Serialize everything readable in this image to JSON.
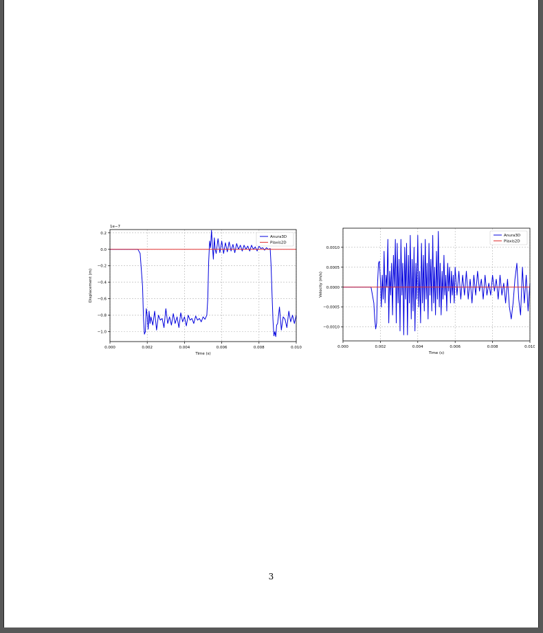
{
  "page": {
    "number": "3"
  },
  "chart_data": [
    {
      "type": "line",
      "title": "",
      "xlabel": "Time (s)",
      "ylabel": "Displacement (m)",
      "y_offset_text": "1e−7",
      "xlim": [
        0,
        0.01
      ],
      "ylim": [
        -1.12,
        0.24
      ],
      "xticks": [
        0,
        0.002,
        0.004,
        0.006,
        0.008,
        0.01
      ],
      "xtick_labels": [
        "0.000",
        "0.002",
        "0.004",
        "0.006",
        "0.008",
        "0.010"
      ],
      "yticks": [
        -1.0,
        -0.8,
        -0.6,
        -0.4,
        -0.2,
        0.0,
        0.2
      ],
      "ytick_labels": [
        "−1.0",
        "−0.8",
        "−0.6",
        "−0.4",
        "−0.2",
        "0.0",
        "0.2"
      ],
      "grid": true,
      "legend_position": "top-right",
      "series": [
        {
          "name": "Anura3D",
          "color": "#0000dd",
          "x": [
            0,
            0.0015,
            0.00162,
            0.00175,
            0.0018,
            0.00185,
            0.0019,
            0.00195,
            0.002,
            0.00205,
            0.0021,
            0.00215,
            0.0022,
            0.0023,
            0.0024,
            0.0025,
            0.0026,
            0.0027,
            0.0028,
            0.0029,
            0.003,
            0.0031,
            0.0032,
            0.0033,
            0.0034,
            0.0035,
            0.0036,
            0.0037,
            0.0038,
            0.0039,
            0.004,
            0.0041,
            0.0042,
            0.0043,
            0.0044,
            0.0045,
            0.0046,
            0.0047,
            0.0048,
            0.0049,
            0.005,
            0.0051,
            0.0052,
            0.00525,
            0.0053,
            0.00535,
            0.0054,
            0.00545,
            0.0055,
            0.00555,
            0.0056,
            0.00565,
            0.0057,
            0.0058,
            0.0059,
            0.006,
            0.0061,
            0.0062,
            0.0063,
            0.0064,
            0.0065,
            0.0066,
            0.0067,
            0.0068,
            0.0069,
            0.007,
            0.0071,
            0.0072,
            0.0073,
            0.0074,
            0.0075,
            0.0076,
            0.0077,
            0.0078,
            0.0079,
            0.008,
            0.0081,
            0.0082,
            0.0083,
            0.0084,
            0.0085,
            0.0086,
            0.00865,
            0.0087,
            0.00875,
            0.0088,
            0.00885,
            0.0089,
            0.00895,
            0.009,
            0.0091,
            0.0092,
            0.0093,
            0.0094,
            0.0095,
            0.0096,
            0.0097,
            0.0098,
            0.0099,
            0.01
          ],
          "values": [
            0,
            0,
            -0.05,
            -0.45,
            -0.85,
            -1.03,
            -1.0,
            -0.72,
            -0.8,
            -0.97,
            -0.75,
            -0.9,
            -0.82,
            -0.92,
            -0.75,
            -0.98,
            -0.8,
            -0.86,
            -0.84,
            -0.95,
            -0.72,
            -0.9,
            -0.82,
            -0.92,
            -0.78,
            -0.9,
            -0.82,
            -0.95,
            -0.77,
            -0.88,
            -0.82,
            -0.93,
            -0.8,
            -0.86,
            -0.84,
            -0.9,
            -0.81,
            -0.86,
            -0.84,
            -0.88,
            -0.82,
            -0.85,
            -0.8,
            -0.6,
            -0.15,
            0.1,
            0.02,
            0.23,
            0.05,
            -0.12,
            0.14,
            0.0,
            -0.05,
            0.13,
            -0.04,
            0.1,
            -0.05,
            0.08,
            -0.03,
            0.09,
            -0.02,
            0.06,
            -0.04,
            0.07,
            0.0,
            0.05,
            -0.02,
            0.05,
            0.0,
            0.04,
            -0.02,
            0.05,
            0.0,
            0.03,
            -0.02,
            0.04,
            0.01,
            0.02,
            -0.01,
            0.02,
            0.0,
            0.01,
            -0.2,
            -0.55,
            -0.85,
            -1.05,
            -1.0,
            -1.06,
            -0.92,
            -0.9,
            -0.7,
            -0.98,
            -0.82,
            -0.85,
            -0.95,
            -0.75,
            -0.88,
            -0.8,
            -0.9,
            -0.8
          ]
        },
        {
          "name": "Plaxis2D",
          "color": "#e03030",
          "x": [
            0,
            0.01
          ],
          "values": [
            0,
            0
          ]
        }
      ]
    },
    {
      "type": "line",
      "title": "",
      "xlabel": "Time (s)",
      "ylabel": "Velocity (m/s)",
      "xlim": [
        0,
        0.01
      ],
      "ylim": [
        -0.00135,
        0.00148
      ],
      "xticks": [
        0,
        0.002,
        0.004,
        0.006,
        0.008,
        0.01
      ],
      "xtick_labels": [
        "0.000",
        "0.002",
        "0.004",
        "0.006",
        "0.008",
        "0.010"
      ],
      "yticks": [
        -0.001,
        -0.0005,
        0,
        0.0005,
        0.001
      ],
      "ytick_labels": [
        "−0.0010",
        "−0.0005",
        "0.0000",
        "0.0005",
        "0.0010"
      ],
      "grid": true,
      "legend_position": "top-right",
      "series": [
        {
          "name": "Anura3D",
          "color": "#0000dd",
          "x": [
            0,
            0.0015,
            0.00165,
            0.0017,
            0.00175,
            0.0018,
            0.00185,
            0.0019,
            0.00195,
            0.002,
            0.00205,
            0.0021,
            0.00215,
            0.0022,
            0.00225,
            0.0023,
            0.00235,
            0.0024,
            0.00245,
            0.0025,
            0.00255,
            0.0026,
            0.00265,
            0.0027,
            0.00275,
            0.0028,
            0.00285,
            0.0029,
            0.00295,
            0.003,
            0.00305,
            0.0031,
            0.00315,
            0.0032,
            0.00325,
            0.0033,
            0.00335,
            0.0034,
            0.00345,
            0.0035,
            0.00355,
            0.0036,
            0.00365,
            0.0037,
            0.00375,
            0.0038,
            0.00385,
            0.0039,
            0.00395,
            0.004,
            0.00405,
            0.0041,
            0.00415,
            0.0042,
            0.00425,
            0.0043,
            0.00435,
            0.0044,
            0.00445,
            0.0045,
            0.00455,
            0.0046,
            0.00465,
            0.0047,
            0.00475,
            0.0048,
            0.00485,
            0.0049,
            0.00495,
            0.005,
            0.00505,
            0.0051,
            0.00515,
            0.0052,
            0.00525,
            0.0053,
            0.00535,
            0.0054,
            0.00545,
            0.0055,
            0.00555,
            0.0056,
            0.00565,
            0.0057,
            0.00575,
            0.0058,
            0.00585,
            0.0059,
            0.00595,
            0.006,
            0.0061,
            0.0062,
            0.0063,
            0.0064,
            0.0065,
            0.0066,
            0.0067,
            0.0068,
            0.0069,
            0.007,
            0.0071,
            0.0072,
            0.0073,
            0.0074,
            0.0075,
            0.0076,
            0.0077,
            0.0078,
            0.0079,
            0.008,
            0.0081,
            0.0082,
            0.0083,
            0.0084,
            0.0085,
            0.0086,
            0.0087,
            0.0088,
            0.0089,
            0.009,
            0.0091,
            0.0092,
            0.0093,
            0.0094,
            0.0095,
            0.0096,
            0.0097,
            0.0098,
            0.0099,
            0.01
          ],
          "values": [
            0,
            0,
            -0.0004,
            -0.0008,
            -0.00105,
            -0.0009,
            0.0001,
            0.0006,
            0.00065,
            0.0002,
            -0.0005,
            0.0003,
            -0.0003,
            0.0009,
            -0.0004,
            0.0003,
            0.0,
            0.0012,
            -0.0009,
            0.0004,
            -0.0002,
            0.0006,
            -0.0007,
            0.0008,
            0.0,
            0.0012,
            -0.0009,
            0.0011,
            -0.0004,
            0.0007,
            -0.0011,
            0.0012,
            -0.0002,
            0.0006,
            -0.0012,
            0.001,
            -0.0003,
            0.0011,
            -0.0012,
            0.0008,
            -0.0004,
            0.0013,
            -0.0008,
            0.0007,
            -0.0006,
            0.001,
            -0.0011,
            0.0006,
            -0.0003,
            0.0013,
            -0.0005,
            0.0004,
            -0.0009,
            0.0011,
            -0.0004,
            0.0008,
            -0.0006,
            0.0012,
            -0.0003,
            0.0006,
            -0.0008,
            0.0011,
            -0.0002,
            0.0007,
            -0.0006,
            0.0013,
            -0.0004,
            0.0005,
            -0.0007,
            0.0009,
            -0.0003,
            0.0014,
            -0.0005,
            0.0006,
            -0.0007,
            0.0004,
            -0.0003,
            0.0008,
            -0.0002,
            0.0003,
            -0.0006,
            0.0006,
            -0.0001,
            0.0005,
            -0.0004,
            0.0004,
            -0.0002,
            0.0003,
            -0.0004,
            0.0005,
            -0.0002,
            0.0004,
            -0.0003,
            0.0003,
            -0.0002,
            0.0004,
            -0.0003,
            0.0002,
            -0.0004,
            0.0003,
            -0.0002,
            0.0004,
            -0.0001,
            0.0002,
            -0.0003,
            0.0003,
            -0.0002,
            0.0001,
            -0.0002,
            0.0003,
            -0.0001,
            0.0002,
            -0.0003,
            0.0003,
            -0.0002,
            0.0001,
            -0.0004,
            0.0002,
            -0.0005,
            -0.0008,
            -0.0004,
            0.0002,
            0.0006,
            -0.0003,
            -0.0007,
            0.0005,
            -0.0004,
            0.0003,
            -0.0006,
            0.0001
          ]
        },
        {
          "name": "Plaxis2D",
          "color": "#e03030",
          "x": [
            0,
            0.01
          ],
          "values": [
            0,
            0
          ]
        }
      ]
    }
  ]
}
